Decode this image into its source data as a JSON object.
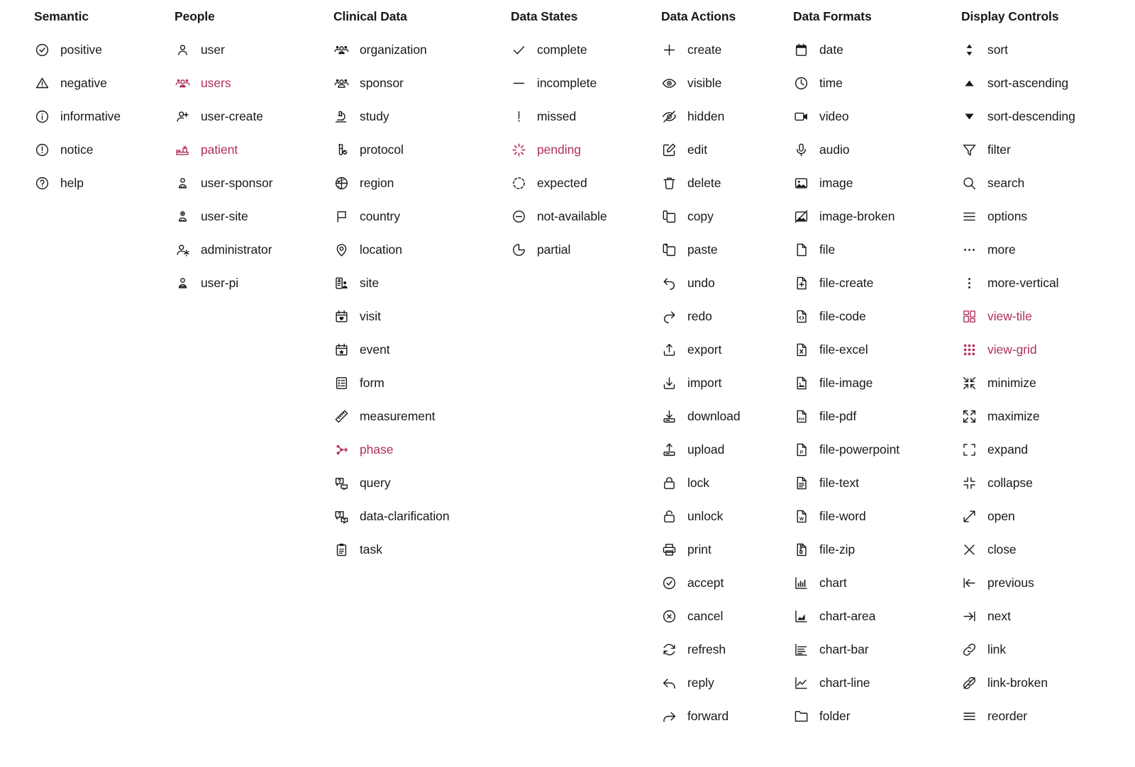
{
  "accent_color": "#b03058",
  "text_color": "#16191d",
  "background_color": "#ffffff",
  "columns": [
    {
      "title": "Semantic",
      "items": [
        {
          "label": "positive",
          "icon": "check-circle-icon",
          "highlighted": false
        },
        {
          "label": "negative",
          "icon": "warning-triangle-icon",
          "highlighted": false
        },
        {
          "label": "informative",
          "icon": "info-circle-icon",
          "highlighted": false
        },
        {
          "label": "notice",
          "icon": "exclamation-circle-icon",
          "highlighted": false
        },
        {
          "label": "help",
          "icon": "question-circle-icon",
          "highlighted": false
        }
      ]
    },
    {
      "title": "People",
      "items": [
        {
          "label": "user",
          "icon": "user-icon",
          "highlighted": false
        },
        {
          "label": "users",
          "icon": "users-icon",
          "highlighted": true
        },
        {
          "label": "user-create",
          "icon": "user-plus-icon",
          "highlighted": false
        },
        {
          "label": "patient",
          "icon": "patient-bed-icon",
          "highlighted": true
        },
        {
          "label": "user-sponsor",
          "icon": "user-sponsor-icon",
          "highlighted": false
        },
        {
          "label": "user-site",
          "icon": "user-site-icon",
          "highlighted": false
        },
        {
          "label": "administrator",
          "icon": "user-gear-icon",
          "highlighted": false
        },
        {
          "label": "user-pi",
          "icon": "user-pi-icon",
          "highlighted": false
        }
      ]
    },
    {
      "title": "Clinical Data",
      "items": [
        {
          "label": "organization",
          "icon": "organization-icon",
          "highlighted": false
        },
        {
          "label": "sponsor",
          "icon": "sponsor-icon",
          "highlighted": false
        },
        {
          "label": "study",
          "icon": "microscope-icon",
          "highlighted": false
        },
        {
          "label": "protocol",
          "icon": "protocol-vial-icon",
          "highlighted": false
        },
        {
          "label": "region",
          "icon": "globe-icon",
          "highlighted": false
        },
        {
          "label": "country",
          "icon": "flag-icon",
          "highlighted": false
        },
        {
          "label": "location",
          "icon": "map-pin-icon",
          "highlighted": false
        },
        {
          "label": "site",
          "icon": "site-icon",
          "highlighted": false
        },
        {
          "label": "visit",
          "icon": "calendar-heart-icon",
          "highlighted": false
        },
        {
          "label": "event",
          "icon": "calendar-star-icon",
          "highlighted": false
        },
        {
          "label": "form",
          "icon": "form-icon",
          "highlighted": false
        },
        {
          "label": "measurement",
          "icon": "ruler-icon",
          "highlighted": false
        },
        {
          "label": "phase",
          "icon": "phase-icon",
          "highlighted": true
        },
        {
          "label": "query",
          "icon": "query-bubble-icon",
          "highlighted": false
        },
        {
          "label": "data-clarification",
          "icon": "clarification-icon",
          "highlighted": false
        },
        {
          "label": "task",
          "icon": "clipboard-icon",
          "highlighted": false
        }
      ]
    },
    {
      "title": "Data States",
      "items": [
        {
          "label": "complete",
          "icon": "check-icon",
          "highlighted": false
        },
        {
          "label": "incomplete",
          "icon": "dash-icon",
          "highlighted": false
        },
        {
          "label": "missed",
          "icon": "exclamation-icon",
          "highlighted": false
        },
        {
          "label": "pending",
          "icon": "spinner-icon",
          "highlighted": true
        },
        {
          "label": "expected",
          "icon": "dashed-circle-icon",
          "highlighted": false
        },
        {
          "label": "not-available",
          "icon": "minus-circle-icon",
          "highlighted": false
        },
        {
          "label": "partial",
          "icon": "partial-pie-icon",
          "highlighted": false
        }
      ]
    },
    {
      "title": "Data Actions",
      "items": [
        {
          "label": "create",
          "icon": "plus-icon",
          "highlighted": false
        },
        {
          "label": "visible",
          "icon": "eye-icon",
          "highlighted": false
        },
        {
          "label": "hidden",
          "icon": "eye-off-icon",
          "highlighted": false
        },
        {
          "label": "edit",
          "icon": "pencil-square-icon",
          "highlighted": false
        },
        {
          "label": "delete",
          "icon": "trash-icon",
          "highlighted": false
        },
        {
          "label": "copy",
          "icon": "copy-icon",
          "highlighted": false
        },
        {
          "label": "paste",
          "icon": "paste-icon",
          "highlighted": false
        },
        {
          "label": "undo",
          "icon": "undo-arrow-icon",
          "highlighted": false
        },
        {
          "label": "redo",
          "icon": "redo-arrow-icon",
          "highlighted": false
        },
        {
          "label": "export",
          "icon": "export-icon",
          "highlighted": false
        },
        {
          "label": "import",
          "icon": "import-icon",
          "highlighted": false
        },
        {
          "label": "download",
          "icon": "download-icon",
          "highlighted": false
        },
        {
          "label": "upload",
          "icon": "upload-icon",
          "highlighted": false
        },
        {
          "label": "lock",
          "icon": "lock-icon",
          "highlighted": false
        },
        {
          "label": "unlock",
          "icon": "unlock-icon",
          "highlighted": false
        },
        {
          "label": "print",
          "icon": "printer-icon",
          "highlighted": false
        },
        {
          "label": "accept",
          "icon": "check-circle-icon",
          "highlighted": false
        },
        {
          "label": "cancel",
          "icon": "x-circle-icon",
          "highlighted": false
        },
        {
          "label": "refresh",
          "icon": "refresh-icon",
          "highlighted": false
        },
        {
          "label": "reply",
          "icon": "reply-arrow-icon",
          "highlighted": false
        },
        {
          "label": "forward",
          "icon": "forward-arrow-icon",
          "highlighted": false
        }
      ]
    },
    {
      "title": "Data Formats",
      "items": [
        {
          "label": "date",
          "icon": "calendar-icon",
          "highlighted": false
        },
        {
          "label": "time",
          "icon": "clock-icon",
          "highlighted": false
        },
        {
          "label": "video",
          "icon": "video-camera-icon",
          "highlighted": false
        },
        {
          "label": "audio",
          "icon": "microphone-icon",
          "highlighted": false
        },
        {
          "label": "image",
          "icon": "image-icon",
          "highlighted": false
        },
        {
          "label": "image-broken",
          "icon": "image-broken-icon",
          "highlighted": false
        },
        {
          "label": "file",
          "icon": "file-icon",
          "highlighted": false
        },
        {
          "label": "file-create",
          "icon": "file-plus-icon",
          "highlighted": false
        },
        {
          "label": "file-code",
          "icon": "file-code-icon",
          "highlighted": false
        },
        {
          "label": "file-excel",
          "icon": "file-excel-icon",
          "highlighted": false
        },
        {
          "label": "file-image",
          "icon": "file-image-icon",
          "highlighted": false
        },
        {
          "label": "file-pdf",
          "icon": "file-pdf-icon",
          "highlighted": false
        },
        {
          "label": "file-powerpoint",
          "icon": "file-powerpoint-icon",
          "highlighted": false
        },
        {
          "label": "file-text",
          "icon": "file-text-icon",
          "highlighted": false
        },
        {
          "label": "file-word",
          "icon": "file-word-icon",
          "highlighted": false
        },
        {
          "label": "file-zip",
          "icon": "file-zip-icon",
          "highlighted": false
        },
        {
          "label": "chart",
          "icon": "chart-icon",
          "highlighted": false
        },
        {
          "label": "chart-area",
          "icon": "chart-area-icon",
          "highlighted": false
        },
        {
          "label": "chart-bar",
          "icon": "chart-bar-icon",
          "highlighted": false
        },
        {
          "label": "chart-line",
          "icon": "chart-line-icon",
          "highlighted": false
        },
        {
          "label": "folder",
          "icon": "folder-icon",
          "highlighted": false
        }
      ]
    },
    {
      "title": "Display Controls",
      "items": [
        {
          "label": "sort",
          "icon": "sort-icon",
          "highlighted": false
        },
        {
          "label": "sort-ascending",
          "icon": "triangle-up-icon",
          "highlighted": false
        },
        {
          "label": "sort-descending",
          "icon": "triangle-down-icon",
          "highlighted": false
        },
        {
          "label": "filter",
          "icon": "funnel-icon",
          "highlighted": false
        },
        {
          "label": "search",
          "icon": "search-icon",
          "highlighted": false
        },
        {
          "label": "options",
          "icon": "hamburger-icon",
          "highlighted": false
        },
        {
          "label": "more",
          "icon": "more-horizontal-icon",
          "highlighted": false
        },
        {
          "label": "more-vertical",
          "icon": "more-vertical-icon",
          "highlighted": false
        },
        {
          "label": "view-tile",
          "icon": "view-tile-icon",
          "highlighted": true
        },
        {
          "label": "view-grid",
          "icon": "view-grid-icon",
          "highlighted": true
        },
        {
          "label": "minimize",
          "icon": "minimize-icon",
          "highlighted": false
        },
        {
          "label": "maximize",
          "icon": "maximize-icon",
          "highlighted": false
        },
        {
          "label": "expand",
          "icon": "expand-icon",
          "highlighted": false
        },
        {
          "label": "collapse",
          "icon": "collapse-icon",
          "highlighted": false
        },
        {
          "label": "open",
          "icon": "open-external-icon",
          "highlighted": false
        },
        {
          "label": "close",
          "icon": "x-icon",
          "highlighted": false
        },
        {
          "label": "previous",
          "icon": "previous-icon",
          "highlighted": false
        },
        {
          "label": "next",
          "icon": "next-icon",
          "highlighted": false
        },
        {
          "label": "link",
          "icon": "link-icon",
          "highlighted": false
        },
        {
          "label": "link-broken",
          "icon": "link-broken-icon",
          "highlighted": false
        },
        {
          "label": "reorder",
          "icon": "reorder-icon",
          "highlighted": false
        }
      ]
    }
  ]
}
